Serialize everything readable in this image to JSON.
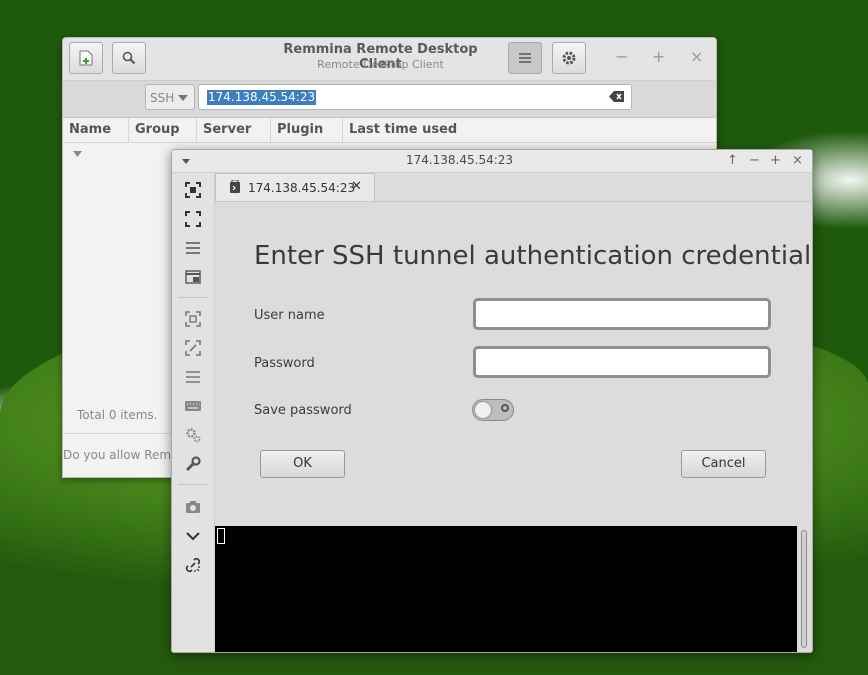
{
  "main_window": {
    "title": "Remmina Remote Desktop Client",
    "subtitle": "Remote Desktop Client",
    "protocol": "SSH",
    "address": "174.138.45.54:23",
    "columns": [
      "Name",
      "Group",
      "Server",
      "Plugin",
      "Last time used"
    ],
    "total_items": "Total 0 items.",
    "allow_message": "Do you allow Remmina to"
  },
  "connection_window": {
    "title": "174.138.45.54:23",
    "tab_label": "174.138.45.54:23",
    "heading": "Enter SSH tunnel authentication credentials",
    "username_label": "User name",
    "password_label": "Password",
    "save_password_label": "Save password",
    "save_password_on": false,
    "ok_label": "OK",
    "cancel_label": "Cancel"
  },
  "colors": {
    "selection": "#3d7ebf",
    "terminal_bg": "#000000",
    "dialog_bg": "#dcdcdc"
  }
}
